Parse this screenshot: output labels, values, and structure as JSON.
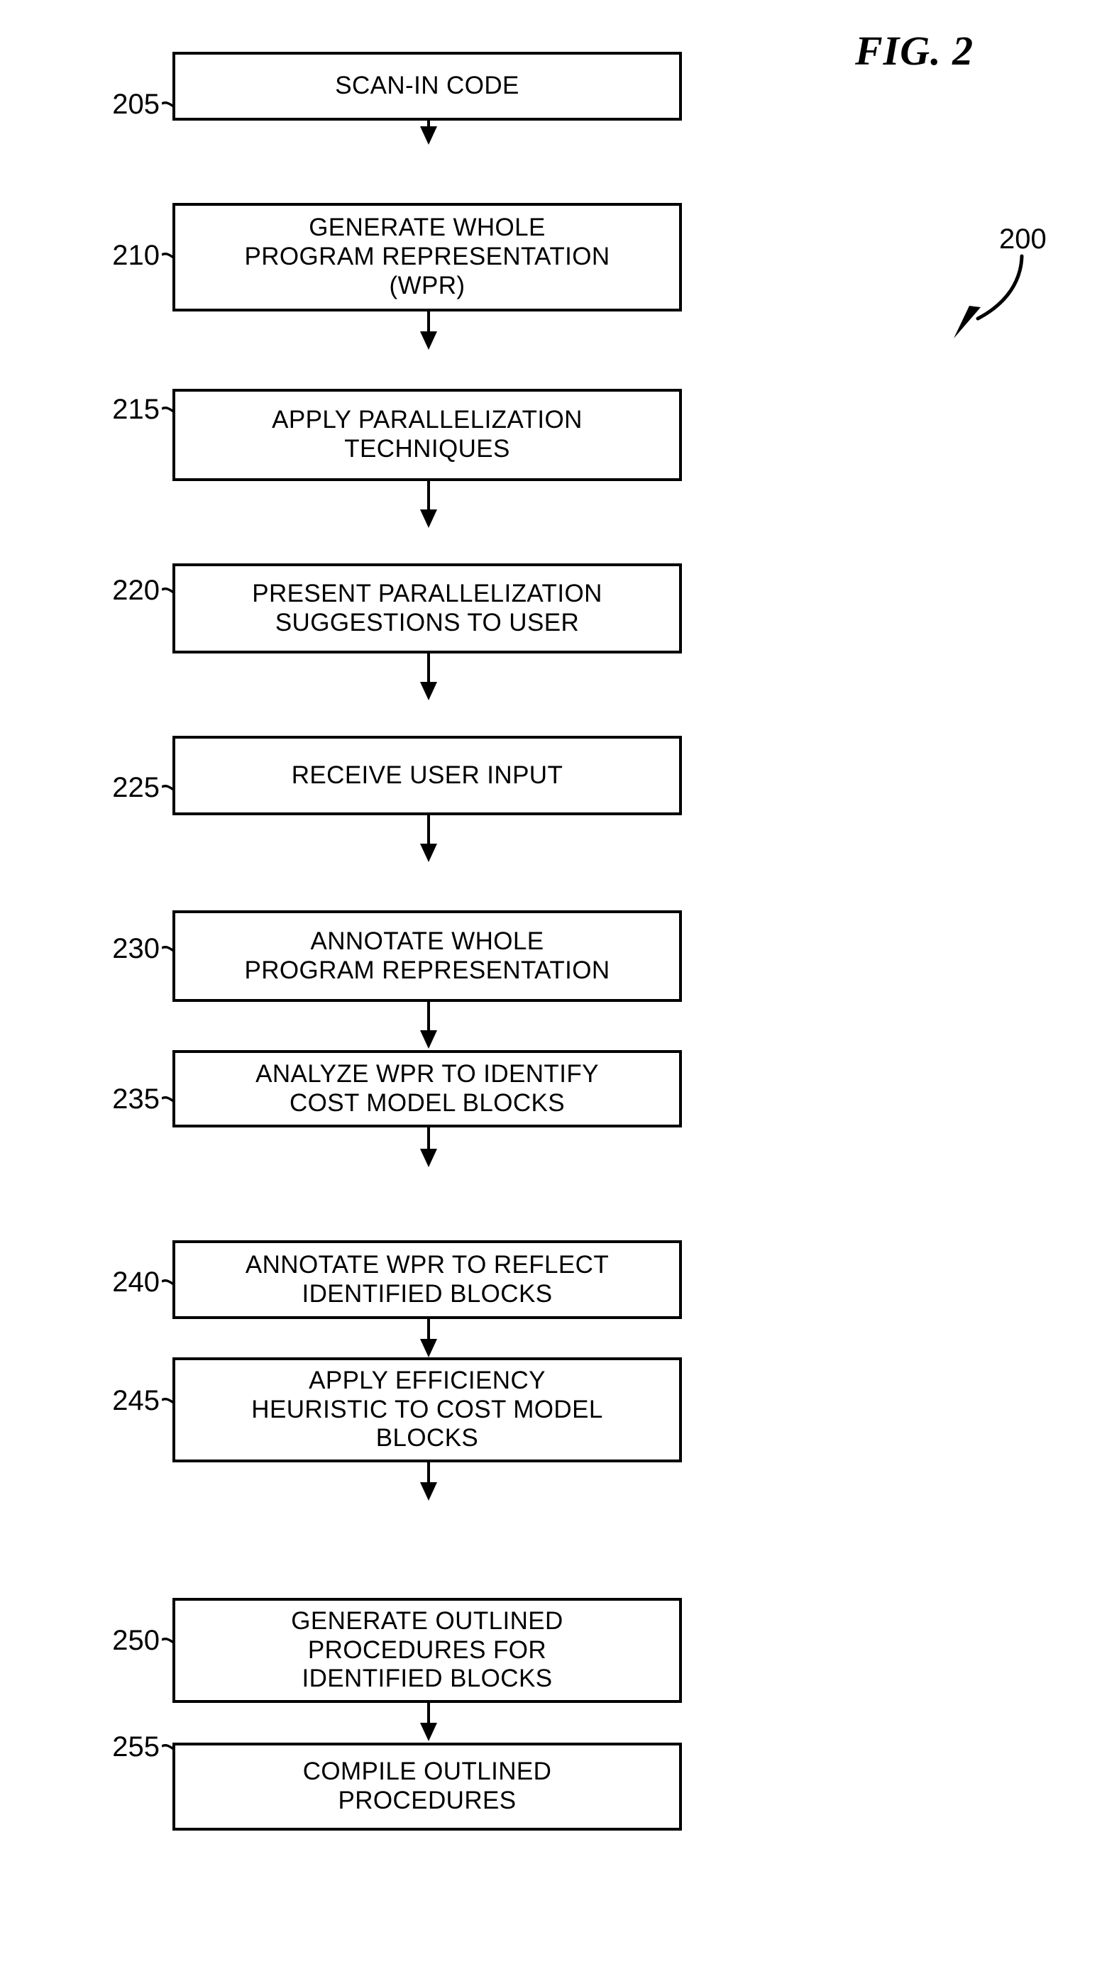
{
  "figure": {
    "title": "FIG. 2",
    "reference_number": "200",
    "reference_arrow_icon": "curved-arrow-icon"
  },
  "flowchart": {
    "type": "process-flow",
    "direction": "top-to-bottom",
    "steps": [
      {
        "ref": "205",
        "label": "SCAN-IN CODE"
      },
      {
        "ref": "210",
        "label": "GENERATE WHOLE\nPROGRAM REPRESENTATION\n(WPR)"
      },
      {
        "ref": "215",
        "label": "APPLY PARALLELIZATION\nTECHNIQUES"
      },
      {
        "ref": "220",
        "label": "PRESENT PARALLELIZATION\nSUGGESTIONS TO USER"
      },
      {
        "ref": "225",
        "label": "RECEIVE USER INPUT"
      },
      {
        "ref": "230",
        "label": "ANNOTATE WHOLE\nPROGRAM REPRESENTATION"
      },
      {
        "ref": "235",
        "label": "ANALYZE WPR TO IDENTIFY\nCOST MODEL BLOCKS"
      },
      {
        "ref": "240",
        "label": "ANNOTATE WPR TO REFLECT\nIDENTIFIED BLOCKS"
      },
      {
        "ref": "245",
        "label": "APPLY EFFICIENCY\nHEURISTIC TO COST MODEL\nBLOCKS"
      },
      {
        "ref": "250",
        "label": "GENERATE OUTLINED\nPROCEDURES FOR\nIDENTIFIED BLOCKS"
      },
      {
        "ref": "255",
        "label": "COMPILE OUTLINED\nPROCEDURES"
      }
    ]
  },
  "colors": {
    "stroke": "#000000",
    "background": "#ffffff"
  }
}
